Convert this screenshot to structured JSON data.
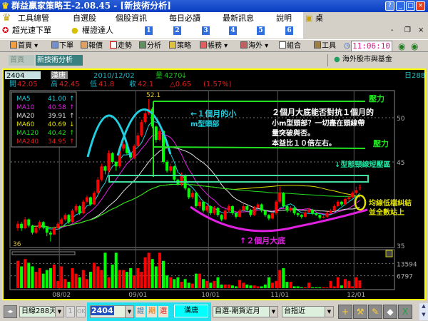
{
  "window": {
    "title": "群益贏家策略王-2.08.45 - [新技術分析]",
    "help": "?",
    "minimize": "_",
    "maximize": "□",
    "close": "×"
  },
  "menu": {
    "items": [
      "工具總管",
      "自選股",
      "個股資訊",
      "每日必讀",
      "最新訊息",
      "說明",
      "桌面"
    ]
  },
  "row2": {
    "items": [
      "超光速下單",
      "權證達人"
    ],
    "numbers": [
      "1",
      "2",
      "3",
      "4",
      "5",
      "6"
    ],
    "mdi_min": "-",
    "mdi_restore": "❐",
    "mdi_close": "×"
  },
  "toolbar": {
    "items": [
      "首頁",
      "下單",
      "報價",
      "走勢",
      "分析",
      "策略",
      "帳務",
      "海外",
      "組合",
      "工具"
    ],
    "clock": "11:06:10"
  },
  "tabs": {
    "items": [
      "首頁",
      "新技術分析"
    ],
    "right_link": "海外股市與基金"
  },
  "quote": {
    "code": "2404",
    "name": "漢唐",
    "date": "2010/12/02",
    "volume_label": "量",
    "volume": "4270",
    "volume_arrow": "↓",
    "period": "日288",
    "open_label": "開",
    "open": "42.05",
    "high_label": "高",
    "high": "42.45",
    "low_label": "低",
    "low": "41.8",
    "close_label": "收",
    "close": "42.1",
    "change": "△0.65",
    "change_pct": "(1.57%)"
  },
  "ma_legend": [
    {
      "name": "MA5",
      "value": "41.00",
      "arrow": "↑",
      "color": "#20d0e0"
    },
    {
      "name": "MA10",
      "value": "40.58",
      "arrow": "↑",
      "color": "#e020e0"
    },
    {
      "name": "MA20",
      "value": "39.91",
      "arrow": "↑",
      "color": "#e0e0e0"
    },
    {
      "name": "MA60",
      "value": "40.69",
      "arrow": "↓",
      "color": "#e0e000"
    },
    {
      "name": "MA120",
      "value": "40.42",
      "arrow": "↑",
      "color": "#20e020"
    },
    {
      "name": "MA240",
      "value": "34.95",
      "arrow": "↑",
      "color": "#e02020"
    }
  ],
  "annotations": {
    "resistance1": "壓力",
    "resistance2": "壓力",
    "head_note_1": "←１個月的小",
    "head_note_2": "m型頭部",
    "main_note": [
      "２個月大底能否對抗１個月的",
      "小m型頭部？一切盡在頭線帶",
      "量突破與否。",
      "本益比１０倍左右。"
    ],
    "neckline_note": "↓型態頸線短壓區",
    "bottom_note": "↑２個月大底",
    "ma_note_1": "均線低檔糾結",
    "ma_note_2": "並全數站上",
    "peak_label": "52.1",
    "low_label": "36"
  },
  "chart_data": {
    "type": "candlestick",
    "price_axis": {
      "ticks": [
        "50",
        "45",
        "35"
      ],
      "range": [
        35,
        53
      ]
    },
    "volume_axis": {
      "ticks": [
        "13594",
        "6797"
      ]
    },
    "x_ticks": [
      "08/02",
      "09/01",
      "10/01",
      "11/01",
      "12/01"
    ],
    "up_color": "#ff0000",
    "down_color": "#00ff00",
    "candles": [
      [
        37.5,
        38.3,
        37.2,
        38,
        15000
      ],
      [
        38,
        38.2,
        37.2,
        37.5,
        12000
      ],
      [
        37.5,
        38.8,
        37.4,
        38.5,
        16000
      ],
      [
        38.5,
        38.6,
        37.6,
        37.8,
        14000
      ],
      [
        37.8,
        37.9,
        36.8,
        37,
        12000
      ],
      [
        37,
        37.8,
        36.9,
        37.5,
        9000
      ],
      [
        37.5,
        38.4,
        37.3,
        38.2,
        11000
      ],
      [
        38.2,
        38.3,
        37.4,
        37.6,
        8000
      ],
      [
        37.6,
        37.7,
        36.6,
        37,
        10000
      ],
      [
        37,
        37.2,
        36,
        36.8,
        11000
      ],
      [
        36.8,
        37.7,
        36.7,
        37.5,
        13000
      ],
      [
        37.5,
        38.2,
        37.3,
        38,
        4000
      ],
      [
        38,
        38.7,
        37.8,
        38.5,
        12000
      ],
      [
        38.5,
        39.2,
        38.3,
        39,
        5000
      ],
      [
        39,
        39.1,
        38,
        38.2,
        3500
      ],
      [
        38.2,
        39.7,
        38.1,
        39.5,
        11000
      ],
      [
        39.5,
        40.2,
        39.3,
        40,
        8000
      ],
      [
        40,
        40.1,
        39,
        39.2,
        6000
      ],
      [
        39.2,
        40.7,
        39.1,
        40.5,
        10000
      ],
      [
        40.5,
        41.2,
        40.3,
        41,
        5000
      ],
      [
        41,
        41.1,
        40,
        40.2,
        9000
      ],
      [
        40.2,
        41.7,
        40.1,
        41.5,
        14000
      ],
      [
        41.5,
        43.3,
        41.4,
        43,
        12000
      ],
      [
        43,
        44.8,
        42.8,
        44.5,
        10000
      ],
      [
        44.5,
        44.6,
        43.6,
        44,
        19500
      ],
      [
        44,
        46.3,
        43.8,
        46,
        6000
      ],
      [
        46,
        46.1,
        44.8,
        45,
        13000
      ],
      [
        45,
        45.1,
        44,
        44.5,
        19500
      ],
      [
        44.5,
        46.8,
        44.3,
        46.5,
        10000
      ],
      [
        46.5,
        47.3,
        46.2,
        47,
        10000
      ],
      [
        47,
        47.1,
        45.8,
        46,
        9000
      ],
      [
        46,
        46.1,
        45.2,
        45.5,
        11000
      ],
      [
        45.5,
        47,
        45.3,
        46.8,
        7000
      ],
      [
        46.8,
        48.3,
        46.6,
        48,
        11000
      ],
      [
        48,
        49.8,
        47.8,
        49.5,
        9000
      ],
      [
        49.5,
        50.8,
        49.3,
        50.5,
        17000
      ],
      [
        50.5,
        52.1,
        50.3,
        51,
        19500
      ],
      [
        51,
        51.2,
        48.8,
        49,
        16000
      ],
      [
        49,
        49.1,
        47.2,
        47.5,
        12000
      ],
      [
        47.5,
        48.8,
        47.3,
        48.5,
        19500
      ],
      [
        48.5,
        48.6,
        44.8,
        45,
        15000
      ],
      [
        45,
        45.2,
        43.8,
        44,
        7000
      ],
      [
        44,
        44.8,
        43.8,
        44.5,
        6000
      ],
      [
        44.5,
        44.6,
        42.8,
        43,
        5000
      ],
      [
        43,
        43.1,
        42.3,
        42.5,
        6000
      ],
      [
        42.5,
        43.8,
        42.3,
        43.5,
        3500
      ],
      [
        43.5,
        43.6,
        41.8,
        42,
        5000
      ],
      [
        42,
        42.1,
        40.8,
        41,
        3000
      ],
      [
        41,
        41.8,
        40.8,
        41.5,
        2500
      ],
      [
        41.5,
        41.6,
        39.8,
        40,
        8000
      ],
      [
        40,
        40.8,
        39.8,
        40.5,
        8000
      ],
      [
        40.5,
        40.6,
        39.3,
        39.5,
        5000
      ],
      [
        39.5,
        40.2,
        39.3,
        40,
        4000
      ],
      [
        40,
        40.1,
        39,
        39.2,
        3000
      ],
      [
        39.2,
        40,
        39,
        39.8,
        4000
      ],
      [
        39.8,
        39.9,
        38.8,
        39,
        6000
      ],
      [
        39,
        39.1,
        38.3,
        38.5,
        2000
      ],
      [
        38.5,
        39.7,
        38.4,
        39.5,
        2000
      ],
      [
        39.5,
        40.2,
        39.3,
        40,
        2000
      ],
      [
        40,
        40.1,
        39,
        39.2,
        1500
      ],
      [
        39.2,
        39.3,
        38.6,
        38.8,
        1000
      ],
      [
        38.8,
        39.7,
        38.7,
        39.5,
        4500
      ],
      [
        39.5,
        40.3,
        39.4,
        40,
        3000
      ],
      [
        40,
        40.1,
        39.4,
        39.6,
        2000
      ],
      [
        39.6,
        39.7,
        38.8,
        39,
        1500
      ],
      [
        39,
        40,
        38.9,
        39.8,
        1500
      ],
      [
        39.8,
        40.4,
        39.6,
        40.2,
        1000
      ],
      [
        40.2,
        40.3,
        39.3,
        39.5,
        1000
      ],
      [
        39.5,
        39.6,
        38.8,
        39,
        2000
      ],
      [
        39,
        39.1,
        38.4,
        38.6,
        6000
      ],
      [
        38.6,
        39.4,
        38.5,
        39.2,
        3000
      ],
      [
        39.2,
        40.7,
        39,
        40.5,
        4000
      ],
      [
        40.5,
        42.2,
        40.3,
        41.5,
        10000
      ],
      [
        41.5,
        41.6,
        39.8,
        40,
        11000
      ],
      [
        40,
        40.1,
        39.3,
        39.5,
        3500
      ],
      [
        39.5,
        40,
        39.3,
        39.8,
        3500
      ],
      [
        39.8,
        39.9,
        39,
        39.2,
        1000
      ],
      [
        39.2,
        39.3,
        38.8,
        39,
        1000
      ],
      [
        39,
        39.1,
        38.6,
        38.8,
        500
      ],
      [
        38.8,
        39.5,
        38.7,
        39.3,
        500
      ],
      [
        39.3,
        39.8,
        39.2,
        39.6,
        3000
      ],
      [
        39.6,
        39.7,
        39,
        39.2,
        500
      ],
      [
        39.2,
        39.3,
        38.9,
        39,
        500
      ],
      [
        39,
        39.1,
        38.5,
        38.7,
        500
      ],
      [
        38.7,
        39,
        38.6,
        38.8,
        500
      ],
      [
        38.8,
        39.4,
        38.7,
        39.2,
        500
      ],
      [
        39.2,
        39.7,
        39.1,
        39.5,
        4000
      ],
      [
        39.5,
        40.2,
        39.4,
        40,
        1000
      ],
      [
        40,
        40.7,
        39.9,
        40.5,
        6000
      ],
      [
        40.5,
        40.6,
        40,
        40.2,
        1500
      ],
      [
        40.2,
        41,
        40.1,
        40.8,
        5000
      ],
      [
        40.8,
        41.2,
        40.5,
        41,
        4000
      ],
      [
        41,
        41.7,
        40.9,
        41.5,
        1000
      ],
      [
        41.5,
        42.2,
        41.3,
        41.8,
        6000
      ],
      [
        42.05,
        42.45,
        41.8,
        42.1,
        4270
      ]
    ]
  },
  "bottom": {
    "period_select": "日線288天",
    "count": "1",
    "ok": "OK",
    "code_input": "2404",
    "btn_stock": "證",
    "btn_futures": "期",
    "btn_option": "選",
    "name_box": "漢唐",
    "watchlist": "自選-期貨近月",
    "index_select": "台指近",
    "scroll_up": "▲",
    "scroll_down": "▼"
  }
}
